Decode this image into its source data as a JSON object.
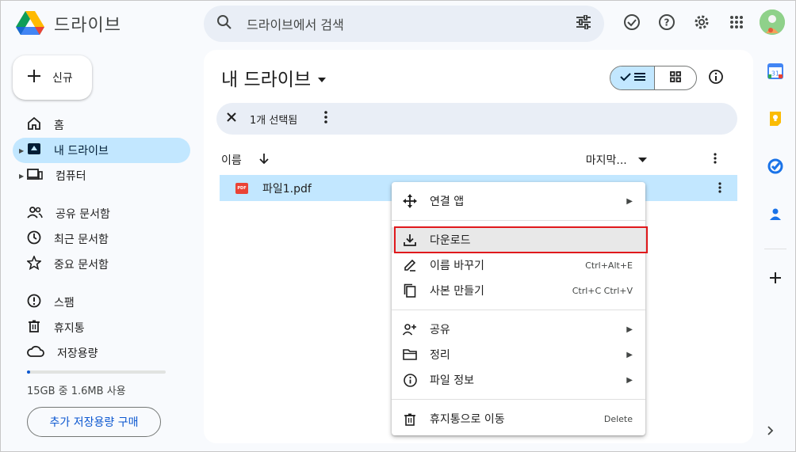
{
  "app": {
    "title": "드라이브"
  },
  "search": {
    "placeholder": "드라이브에서 검색"
  },
  "sidebar": {
    "new_label": "신규",
    "items": [
      {
        "label": "홈"
      },
      {
        "label": "내 드라이브"
      },
      {
        "label": "컴퓨터"
      },
      {
        "label": "공유 문서함"
      },
      {
        "label": "최근 문서함"
      },
      {
        "label": "중요 문서함"
      },
      {
        "label": "스팸"
      },
      {
        "label": "휴지통"
      },
      {
        "label": "저장용량"
      }
    ],
    "storage_text": "15GB 중 1.6MB 사용",
    "storage_fraction": 0.02,
    "buy_label": "추가 저장용량 구매"
  },
  "main": {
    "title": "내 드라이브",
    "selection_text": "1개 선택됨",
    "col_name": "이름",
    "col_modified": "마지막...",
    "files": [
      {
        "name": "파일1.pdf",
        "type": "PDF"
      }
    ]
  },
  "context_menu": {
    "items": [
      {
        "label": "연결 앱",
        "shortcut": "",
        "submenu": true
      },
      {
        "label": "다운로드",
        "shortcut": "",
        "submenu": false,
        "highlighted": true
      },
      {
        "label": "이름 바꾸기",
        "shortcut": "Ctrl+Alt+E",
        "submenu": false
      },
      {
        "label": "사본 만들기",
        "shortcut": "Ctrl+C Ctrl+V",
        "submenu": false
      },
      {
        "label": "공유",
        "shortcut": "",
        "submenu": true
      },
      {
        "label": "정리",
        "shortcut": "",
        "submenu": true
      },
      {
        "label": "파일 정보",
        "shortcut": "",
        "submenu": true
      },
      {
        "label": "휴지통으로 이동",
        "shortcut": "Delete",
        "submenu": false
      }
    ]
  },
  "rail": {
    "calendar_day": "31"
  },
  "colors": {
    "accent": "#0b57d0",
    "selected": "#c2e7ff",
    "highlight_border": "#e0191c"
  }
}
